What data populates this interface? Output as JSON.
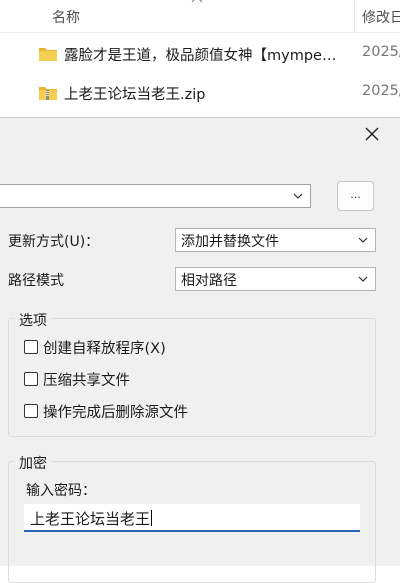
{
  "explorer": {
    "columns": {
      "name": "名称",
      "date": "修改日"
    },
    "files": [
      {
        "name": "露脸才是王道，极品颜值女神【mympe…",
        "date": "2025/",
        "icon": "folder-icon"
      },
      {
        "name": "上老王论坛当老王.zip",
        "date": "2025/",
        "icon": "zip-archive-icon"
      }
    ]
  },
  "dialog": {
    "browse_label": "...",
    "update_mode": {
      "label": "更新方式(U)：",
      "value": "添加并替换文件"
    },
    "path_mode": {
      "label": "路径模式",
      "value": "相对路径"
    },
    "options": {
      "title": "选项",
      "items": [
        {
          "label": "创建自释放程序(X)",
          "checked": false
        },
        {
          "label": "压缩共享文件",
          "checked": false
        },
        {
          "label": "操作完成后删除源文件",
          "checked": false
        }
      ]
    },
    "encryption": {
      "title": "加密",
      "password_label": "输入密码：",
      "password_value": "上老王论坛当老王"
    }
  },
  "colors": {
    "accent": "#2a62b8",
    "folder": "#f0c040",
    "dialog_bg": "#f0f0f0"
  }
}
